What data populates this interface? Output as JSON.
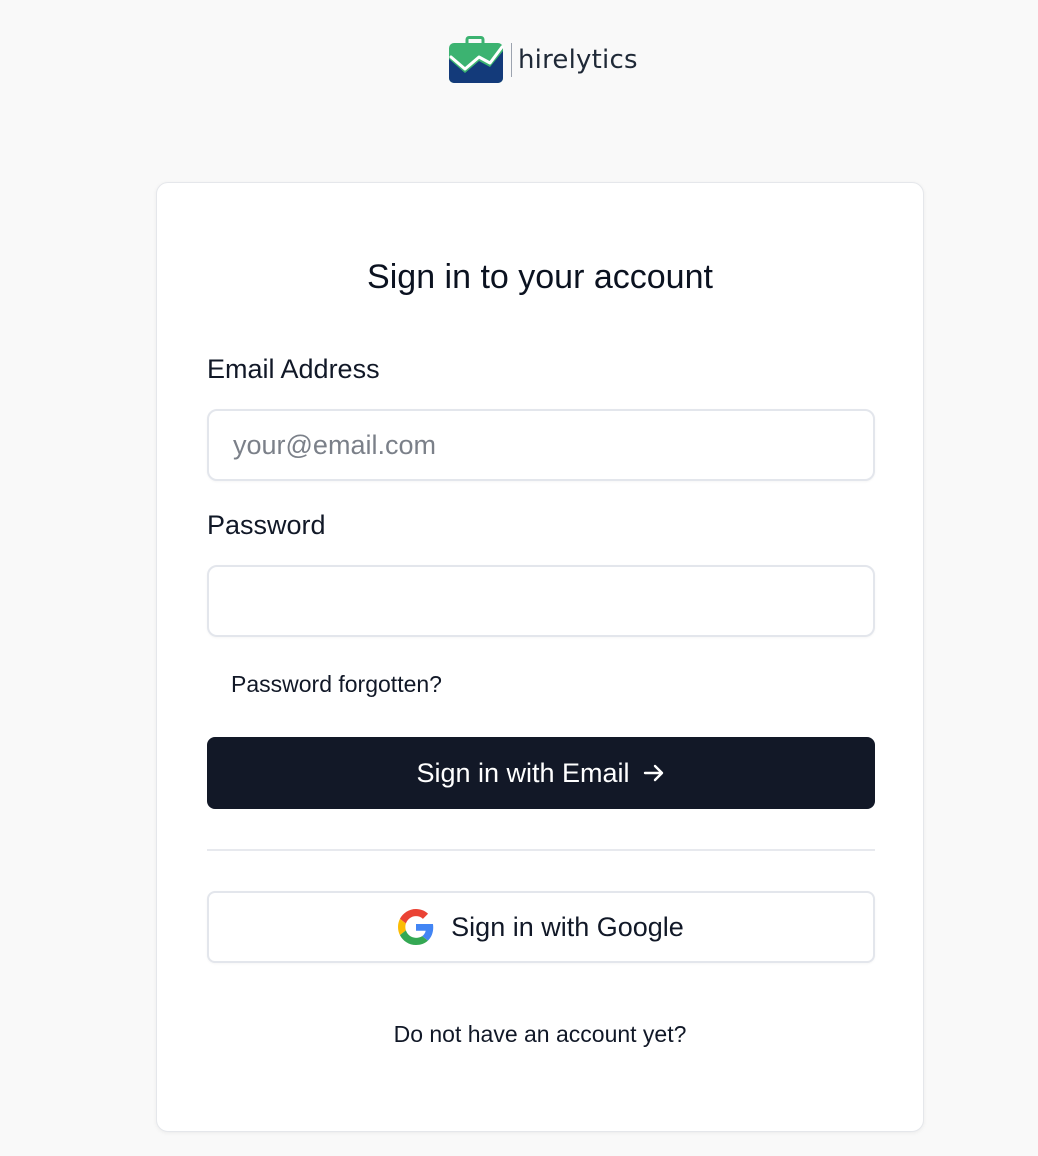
{
  "brand": {
    "name": "hirelytics",
    "colors": {
      "green": "#3cb371",
      "navy": "#133a7a",
      "white": "#ffffff"
    }
  },
  "signin": {
    "title": "Sign in to your account",
    "email_label": "Email Address",
    "email_placeholder": "your@email.com",
    "email_value": "",
    "password_label": "Password",
    "password_value": "",
    "forgot_password": "Password forgotten?",
    "submit_label": "Sign in with Email",
    "submit_icon": "arrow-right-icon",
    "google_label": "Sign in with Google",
    "google_icon": "google-icon",
    "signup_prompt": "Do not have an account yet?"
  },
  "colors": {
    "page_bg": "#f9f9f9",
    "card_bg": "#ffffff",
    "primary_button": "#121827",
    "border": "#e3e6ec",
    "google_blue": "#4285F4",
    "google_green": "#34A853",
    "google_yellow": "#FBBC05",
    "google_red": "#EA4335"
  }
}
